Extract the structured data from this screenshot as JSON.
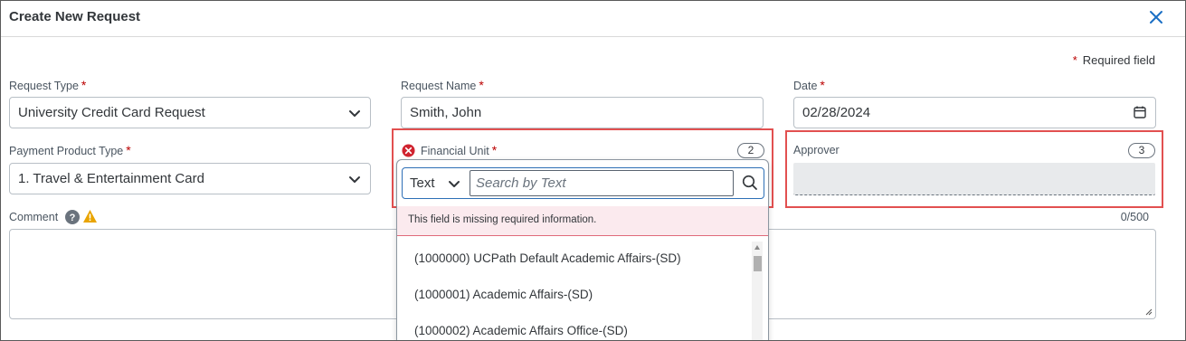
{
  "dialog": {
    "title": "Create New Request",
    "required_note": "Required field",
    "required_star": "*"
  },
  "form": {
    "request_type": {
      "label": "Request Type",
      "value": "University Credit Card Request"
    },
    "request_name": {
      "label": "Request Name",
      "value": "Smith, John"
    },
    "date": {
      "label": "Date",
      "value": "02/28/2024"
    },
    "payment_product_type": {
      "label": "Payment Product Type",
      "value": "1. Travel & Entertainment Card"
    },
    "financial_unit": {
      "label": "Financial Unit",
      "count": "2"
    },
    "approver": {
      "label": "Approver",
      "count": "3"
    },
    "comment": {
      "label": "Comment",
      "counter": "0/500"
    }
  },
  "popover": {
    "search_type": "Text",
    "search_placeholder": "Search by Text",
    "error_message": "This field is missing required information.",
    "items": [
      "(1000000) UCPath Default Academic Affairs-(SD)",
      "(1000001) Academic Affairs-(SD)",
      "(1000002) Academic Affairs Office-(SD)"
    ]
  },
  "colors": {
    "accent": "#2d6fb6",
    "error": "#bb0000",
    "highlight": "#e25050",
    "warning": "#e9a400"
  },
  "icons": [
    "close-icon",
    "chevron-down-icon",
    "calendar-icon",
    "error-icon",
    "help-icon",
    "warning-icon",
    "search-icon"
  ]
}
